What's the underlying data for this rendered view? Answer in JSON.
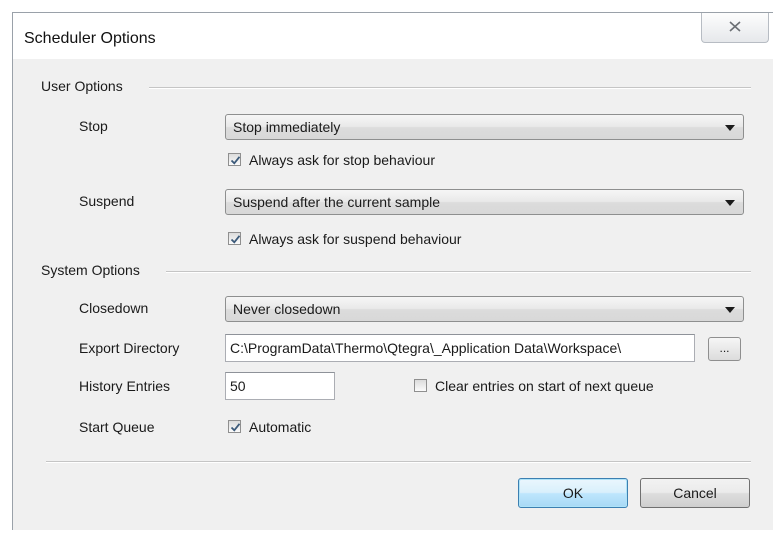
{
  "window": {
    "title": "Scheduler Options"
  },
  "user_options": {
    "group_label": "User Options",
    "stop": {
      "label": "Stop",
      "selected": "Stop immediately"
    },
    "stop_ask": {
      "label": "Always ask for stop behaviour",
      "checked": true
    },
    "suspend": {
      "label": "Suspend",
      "selected": "Suspend after the current sample"
    },
    "suspend_ask": {
      "label": "Always ask for suspend behaviour",
      "checked": true
    }
  },
  "system_options": {
    "group_label": "System Options",
    "closedown": {
      "label": "Closedown",
      "selected": "Never closedown"
    },
    "export_directory": {
      "label": "Export Directory",
      "value": "C:\\ProgramData\\Thermo\\Qtegra\\_Application Data\\Workspace\\",
      "browse_label": "..."
    },
    "history_entries": {
      "label": "History Entries",
      "value": "50"
    },
    "clear_entries": {
      "label": "Clear entries on start of next queue",
      "checked": false
    },
    "start_queue": {
      "label": "Start Queue"
    },
    "automatic": {
      "label": "Automatic",
      "checked": true
    }
  },
  "buttons": {
    "ok": "OK",
    "cancel": "Cancel"
  },
  "icons": {
    "close": "close-icon",
    "dropdown": "chevron-down-icon",
    "check": "checkmark-icon"
  }
}
